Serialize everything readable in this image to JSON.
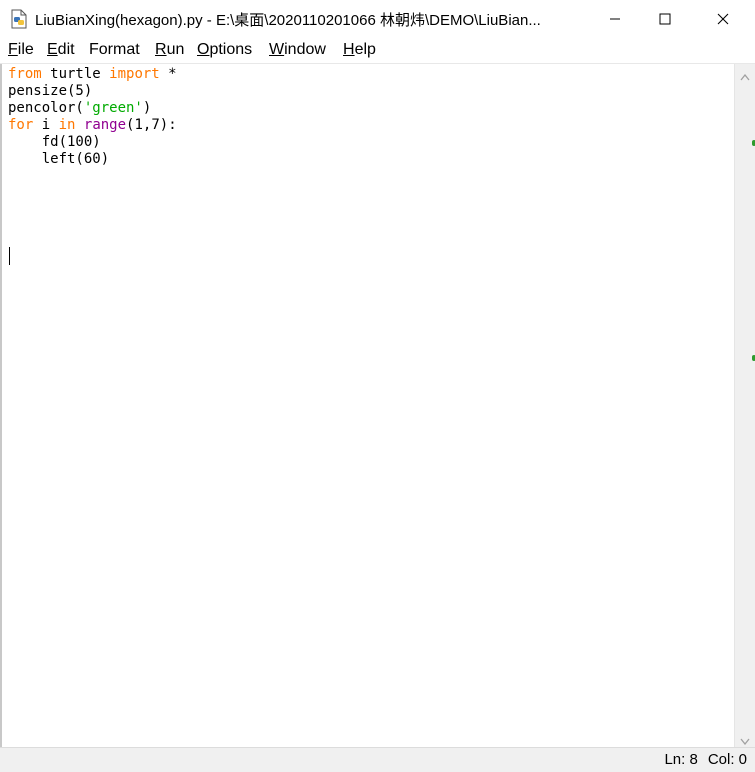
{
  "window": {
    "title": "LiuBianXing(hexagon).py - E:\\桌面\\2020110201066 林朝炜\\DEMO\\LiuBian..."
  },
  "menu": [
    {
      "label": "File",
      "key": "F",
      "rest": "ile"
    },
    {
      "label": "Edit",
      "key": "E",
      "rest": "dit"
    },
    {
      "label": "Format",
      "key": "",
      "rest": "Format"
    },
    {
      "label": "Run",
      "key": "R",
      "rest": "un"
    },
    {
      "label": "Options",
      "key": "O",
      "rest": "ptions"
    },
    {
      "label": "Window",
      "key": "W",
      "rest": "indow"
    },
    {
      "label": "Help",
      "key": "H",
      "rest": "elp"
    }
  ],
  "code": {
    "line1_kw1": "from",
    "line1_mid": " turtle ",
    "line1_kw2": "import",
    "line1_end": " *",
    "line2": "pensize(5)",
    "line3_start": "pencolor(",
    "line3_str": "'green'",
    "line3_end": ")",
    "line4_kw1": "for",
    "line4_mid": " i ",
    "line4_kw2": "in",
    "line4_sp": " ",
    "line4_bi": "range",
    "line4_end": "(1,7):",
    "line5": "    fd(100)",
    "line6": "    left(60)"
  },
  "status": {
    "line": "Ln: 8",
    "col": "Col: 0"
  },
  "colors": {
    "keyword": "#ff7700",
    "builtin": "#900090",
    "string": "#00aa00"
  }
}
